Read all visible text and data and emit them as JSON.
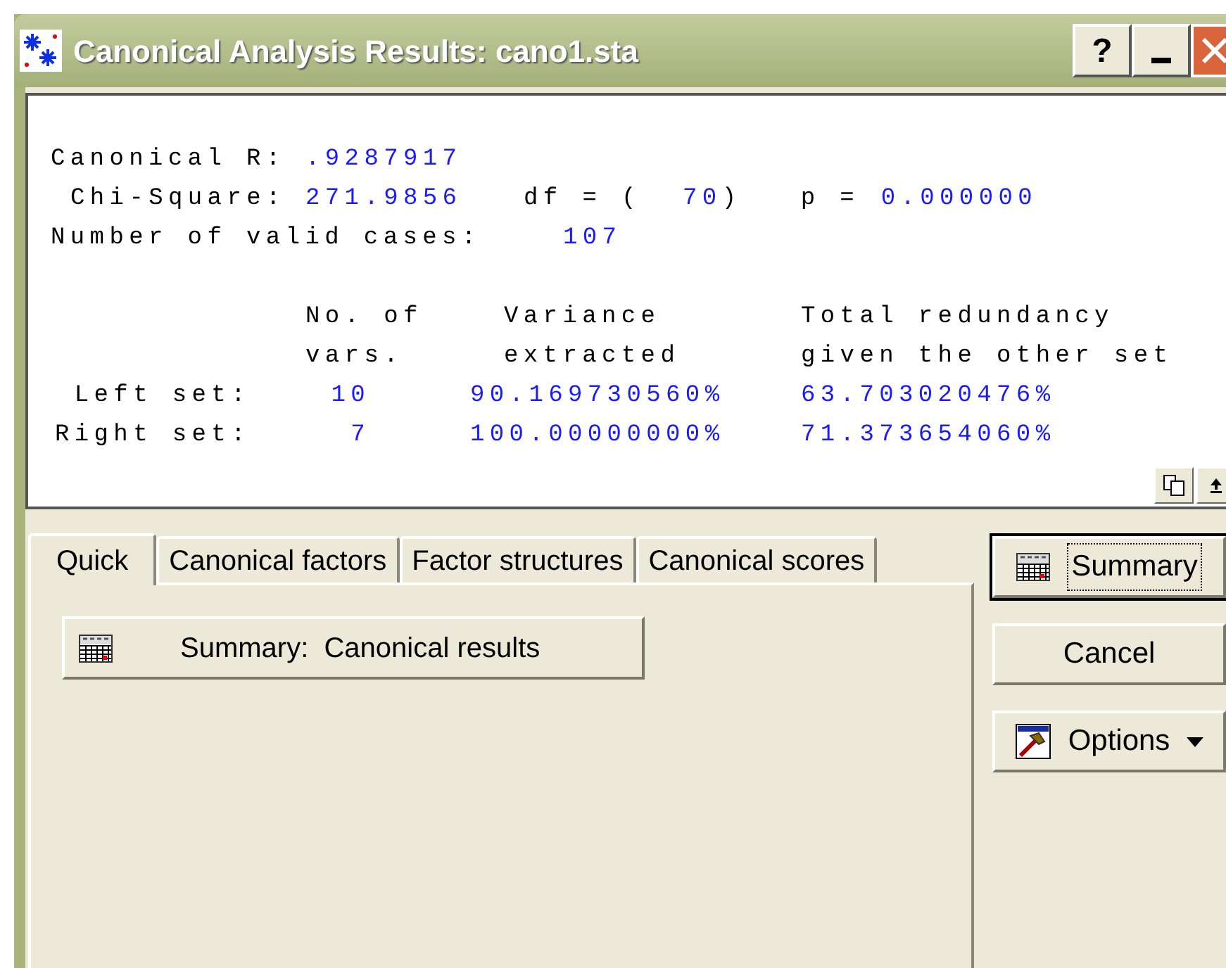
{
  "window": {
    "title": "Canonical Analysis Results: cano1.sta",
    "help_button": "?"
  },
  "report": {
    "canonical_r": {
      "label": "Canonical R:",
      "value": ".9287917"
    },
    "chi_square": {
      "label": "Chi-Square:",
      "value": "271.9856"
    },
    "df": {
      "label": "df = (",
      "value": "70",
      "close": ")"
    },
    "p": {
      "label": "p =",
      "value": "0.000000"
    },
    "valid_cases": {
      "label": "Number of valid cases:",
      "value": "107"
    },
    "columns": [
      [
        "No. of",
        "vars."
      ],
      [
        "Variance",
        "extracted"
      ],
      [
        "Total redundancy",
        "given the other set"
      ]
    ],
    "rows": [
      {
        "label": "Left set:",
        "values": [
          "10",
          "90.169730560%",
          "63.703020476%"
        ]
      },
      {
        "label": "Right set:",
        "values": [
          "7",
          "100.00000000%",
          "71.373654060%"
        ]
      }
    ]
  },
  "tabs": [
    {
      "label": "Quick",
      "selected": true
    },
    {
      "label": "Canonical factors",
      "selected": false
    },
    {
      "label": "Factor structures",
      "selected": false
    },
    {
      "label": "Canonical scores",
      "selected": false
    }
  ],
  "panel_button": "Summary:  Canonical results",
  "side_buttons": [
    {
      "kind": "summary",
      "label": "Summary",
      "default": true
    },
    {
      "kind": "plain",
      "label": "Cancel",
      "default": false
    },
    {
      "kind": "options",
      "label": "Options",
      "default": false
    }
  ]
}
